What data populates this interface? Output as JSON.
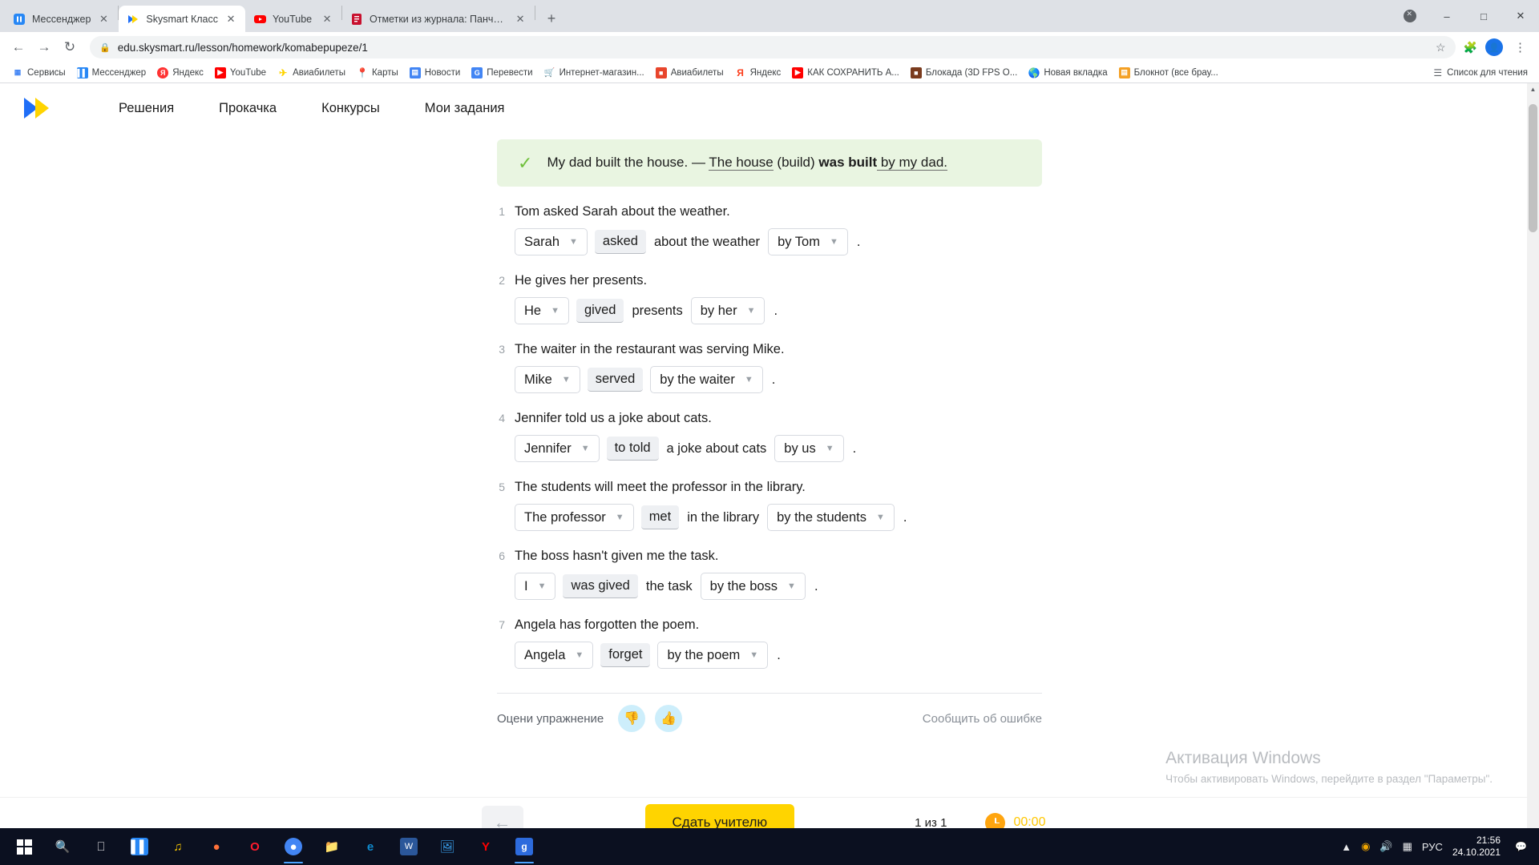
{
  "browser": {
    "tabs": [
      {
        "title": "Мессенджер",
        "favicon": "messenger-icon",
        "color": "#2787f5",
        "active": false
      },
      {
        "title": "Skysmart Класс",
        "favicon": "skysmart-icon",
        "color": "#1f6ef7",
        "active": true
      },
      {
        "title": "YouTube",
        "favicon": "youtube-icon",
        "color": "#ff0000",
        "active": false
      },
      {
        "title": "Отметки из журнала: Панчин К",
        "favicon": "journal-icon",
        "color": "#c8102e",
        "active": false
      }
    ],
    "new_tab_label": "+",
    "window_controls": {
      "minimize": "–",
      "maximize": "□",
      "close": "✕",
      "extra": "✕"
    },
    "nav": {
      "back": "←",
      "forward": "→",
      "reload": "↻"
    },
    "omnibox": {
      "url": "edu.skysmart.ru/lesson/homework/komabepupeze/1",
      "lock": "lock-icon",
      "star": "☆"
    },
    "profile_initial": "",
    "bookmarks": [
      {
        "label": "Сервисы",
        "icon": "apps-grid-icon",
        "color": "#4285f4"
      },
      {
        "label": "Мессенджер",
        "icon": "messenger-icon",
        "color": "#2787f5"
      },
      {
        "label": "Яндекс",
        "icon": "yandex-icon",
        "color": "#ff3333"
      },
      {
        "label": "YouTube",
        "icon": "youtube-icon",
        "color": "#ff0000"
      },
      {
        "label": "Авиабилеты",
        "icon": "plane-icon",
        "color": "#ffd400"
      },
      {
        "label": "Карты",
        "icon": "maps-icon",
        "color": "#34a853"
      },
      {
        "label": "Новости",
        "icon": "news-icon",
        "color": "#4285f4"
      },
      {
        "label": "Перевести",
        "icon": "translate-icon",
        "color": "#4285f4"
      },
      {
        "label": "Интернет-магазин...",
        "icon": "shop-icon",
        "color": "#ea4335"
      },
      {
        "label": "Авиабилеты",
        "icon": "suitcase-icon",
        "color": "#e8452c"
      },
      {
        "label": "Яндекс",
        "icon": "yandex-red-icon",
        "color": "#fc3f1d"
      },
      {
        "label": "КАК СОХРАНИТЬ A...",
        "icon": "youtube-icon",
        "color": "#ff0000"
      },
      {
        "label": "Блокада (3D FPS O...",
        "icon": "game-icon",
        "color": "#7a3b1e"
      },
      {
        "label": "Новая вкладка",
        "icon": "globe-icon",
        "color": "#4a6fa5"
      },
      {
        "label": "Блокнот (все брау...",
        "icon": "notepad-icon",
        "color": "#f4a024"
      }
    ],
    "reading_list": {
      "label": "Список для чтения",
      "icon": "reading-list-icon"
    }
  },
  "site": {
    "logo": "skysmart-logo",
    "nav": [
      {
        "label": "Решения"
      },
      {
        "label": "Прокачка"
      },
      {
        "label": "Конкурсы"
      },
      {
        "label": "Мои задания"
      }
    ]
  },
  "exercise": {
    "example": {
      "check_icon": "checkmark-icon",
      "prompt": "My dad built the house. — ",
      "answer1": "The house",
      "mid": " (build) ",
      "answer2": "was built",
      "tail": " by my dad."
    },
    "questions": [
      {
        "num": "1",
        "sentence": "Tom asked Sarah about the weather.",
        "parts": [
          {
            "type": "select",
            "value": "Sarah"
          },
          {
            "type": "verb",
            "value": "asked"
          },
          {
            "type": "text",
            "value": "about the weather"
          },
          {
            "type": "select",
            "value": "by Tom"
          },
          {
            "type": "period",
            "value": "."
          }
        ]
      },
      {
        "num": "2",
        "sentence": "He gives her presents.",
        "parts": [
          {
            "type": "select",
            "value": "He"
          },
          {
            "type": "verb",
            "value": "gived"
          },
          {
            "type": "text",
            "value": "presents"
          },
          {
            "type": "select",
            "value": "by her"
          },
          {
            "type": "period",
            "value": "."
          }
        ]
      },
      {
        "num": "3",
        "sentence": "The waiter in the restaurant was serving Mike.",
        "parts": [
          {
            "type": "select",
            "value": "Mike"
          },
          {
            "type": "verb",
            "value": "served"
          },
          {
            "type": "select",
            "value": "by the waiter"
          },
          {
            "type": "period",
            "value": "."
          }
        ]
      },
      {
        "num": "4",
        "sentence": "Jennifer told us a joke about cats.",
        "parts": [
          {
            "type": "select",
            "value": "Jennifer"
          },
          {
            "type": "verb",
            "value": "to told"
          },
          {
            "type": "text",
            "value": "a joke about cats"
          },
          {
            "type": "select",
            "value": "by us"
          },
          {
            "type": "period",
            "value": "."
          }
        ]
      },
      {
        "num": "5",
        "sentence": "The students will meet the professor in the library.",
        "parts": [
          {
            "type": "select",
            "value": "The professor"
          },
          {
            "type": "verb",
            "value": "met"
          },
          {
            "type": "text",
            "value": "in the library"
          },
          {
            "type": "select",
            "value": "by the students"
          },
          {
            "type": "period",
            "value": "."
          }
        ]
      },
      {
        "num": "6",
        "sentence": "The boss hasn't given me the task.",
        "parts": [
          {
            "type": "select",
            "value": "I"
          },
          {
            "type": "verb",
            "value": "was gived"
          },
          {
            "type": "text",
            "value": "the task"
          },
          {
            "type": "select",
            "value": "by the boss"
          },
          {
            "type": "period",
            "value": "."
          }
        ]
      },
      {
        "num": "7",
        "sentence": "Angela has forgotten the poem.",
        "parts": [
          {
            "type": "select",
            "value": "Angela"
          },
          {
            "type": "verb",
            "value": "forget"
          },
          {
            "type": "select",
            "value": "by the poem"
          },
          {
            "type": "period",
            "value": "."
          }
        ]
      }
    ],
    "rate": {
      "label": "Оцени упражнение",
      "thumb_down_icon": "thumb-down-icon",
      "thumb_up_icon": "thumb-up-icon",
      "report_label": "Сообщить об ошибке"
    }
  },
  "footer": {
    "back_icon": "arrow-left-icon",
    "submit_label": "Сдать учителю",
    "pager": "1 из 1",
    "timer": "00:00",
    "timer_icon": "clock-icon"
  },
  "watermark": {
    "title": "Активация Windows",
    "subtitle": "Чтобы активировать Windows, перейдите в раздел \"Параметры\"."
  },
  "taskbar": {
    "start_icon": "windows-start-icon",
    "search_icon": "search-icon",
    "taskview_icon": "task-view-icon",
    "items": [
      {
        "name": "messenger-taskbar-icon",
        "glyph": "✉",
        "color": "#2787f5",
        "active": false
      },
      {
        "name": "yandex-music-taskbar-icon",
        "glyph": "♪",
        "color": "#ffcc00",
        "active": false
      },
      {
        "name": "firefox-taskbar-icon",
        "glyph": "●",
        "color": "#ff7139",
        "active": false
      },
      {
        "name": "opera-taskbar-icon",
        "glyph": "O",
        "color": "#ff1b2d",
        "active": false
      },
      {
        "name": "chrome-taskbar-icon",
        "glyph": "●",
        "color": "#4285f4",
        "active": true
      },
      {
        "name": "explorer-taskbar-icon",
        "glyph": "▤",
        "color": "#ffc83d",
        "active": false
      },
      {
        "name": "edge-taskbar-icon",
        "glyph": "e",
        "color": "#0f8bce",
        "active": false
      },
      {
        "name": "word-taskbar-icon",
        "glyph": "W",
        "color": "#2b579a",
        "active": false
      },
      {
        "name": "photos-taskbar-icon",
        "glyph": "▣",
        "color": "#39a0ed",
        "active": false
      },
      {
        "name": "yandex-browser-taskbar-icon",
        "glyph": "Y",
        "color": "#ff0000",
        "active": false
      },
      {
        "name": "grammarly-taskbar-icon",
        "glyph": "g",
        "color": "#15c39a",
        "active": true
      }
    ],
    "tray": {
      "up_arrow": "▲",
      "icons": [
        "network-icon",
        "volume-icon",
        "battery-icon"
      ],
      "language": "РУС",
      "time": "21:56",
      "date": "24.10.2021"
    }
  }
}
